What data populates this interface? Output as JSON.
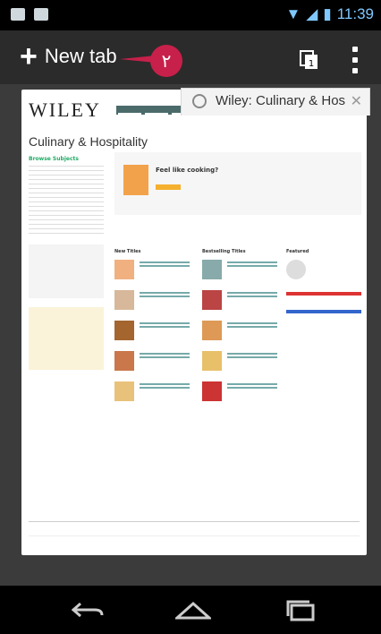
{
  "status": {
    "time": "11:39"
  },
  "toolbar": {
    "new_tab_label": "New tab",
    "callout_text": "۲"
  },
  "tab": {
    "title": "Wiley: Culinary & Hos",
    "close": "✕"
  },
  "page": {
    "brand": "WILEY",
    "title": "Culinary & Hospitality",
    "browse_header": "Browse Subjects",
    "feed_header": "Feel like cooking?",
    "new_titles": "New Titles",
    "bestselling": "Bestselling Titles",
    "featured": "Featured"
  }
}
